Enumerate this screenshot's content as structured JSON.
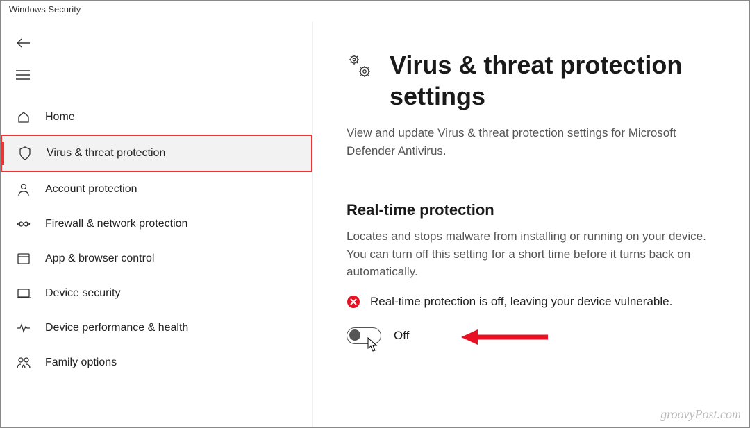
{
  "window": {
    "title": "Windows Security"
  },
  "sidebar": {
    "items": [
      {
        "label": "Home"
      },
      {
        "label": "Virus & threat protection"
      },
      {
        "label": "Account protection"
      },
      {
        "label": "Firewall & network protection"
      },
      {
        "label": "App & browser control"
      },
      {
        "label": "Device security"
      },
      {
        "label": "Device performance & health"
      },
      {
        "label": "Family options"
      }
    ]
  },
  "main": {
    "title": "Virus & threat protection settings",
    "description": "View and update Virus & threat protection settings for Microsoft Defender Antivirus.",
    "section": {
      "title": "Real-time protection",
      "description": "Locates and stops malware from installing or running on your device. You can turn off this setting for a short time before it turns back on automatically.",
      "warning": "Real-time protection is off, leaving your device vulnerable.",
      "toggle_label": "Off"
    }
  },
  "watermark": "groovyPost.com"
}
